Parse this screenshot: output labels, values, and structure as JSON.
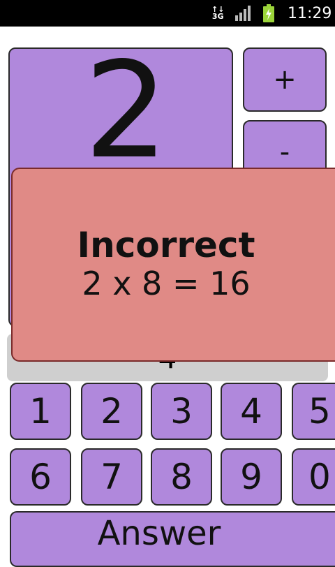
{
  "status_bar": {
    "network_top": "↑↓",
    "network_label": "3G",
    "signal_icon": "signal-bars-icon",
    "battery_icon": "battery-charging-icon",
    "time": "11:29"
  },
  "game": {
    "multiplier": "2",
    "plus_label": "+",
    "minus_label": "-",
    "answer_value": "4"
  },
  "keypad": {
    "row1": [
      "1",
      "2",
      "3",
      "4",
      "5"
    ],
    "row2": [
      "6",
      "7",
      "8",
      "9",
      "0"
    ]
  },
  "answer_button_label": "Answer",
  "toast": {
    "title": "Incorrect",
    "equation": "2 x 8 = 16"
  },
  "colors": {
    "tile": "#b088dc",
    "toast": "#e08a86",
    "answer_box": "#cfcfcf"
  }
}
